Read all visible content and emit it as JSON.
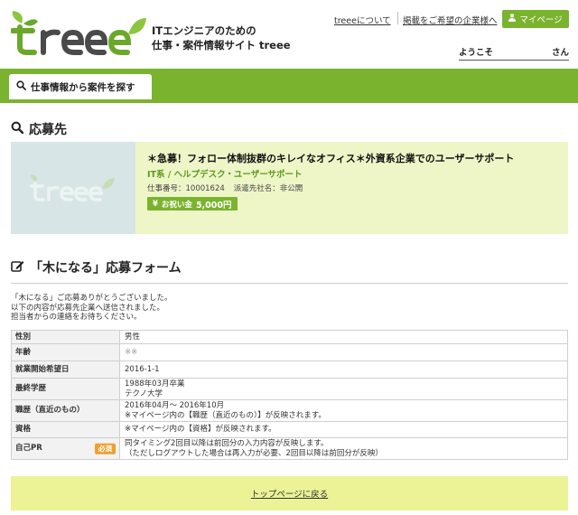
{
  "header": {
    "logo_text": "treee",
    "tagline_line1": "ITエンジニアのための",
    "tagline_line2": "仕事・案件情報サイト treee",
    "link_about": "treeeについて",
    "link_employers": "掲載をご希望の企業様へ",
    "mypage_label": "マイページ",
    "welcome_prefix": "ようこそ",
    "welcome_suffix": "さん"
  },
  "nav": {
    "search_tab": "仕事情報から案件を探す"
  },
  "apply_section": {
    "heading": "応募先"
  },
  "job": {
    "thumb_logo": "treee",
    "title": "＊急募！フォロー体制抜群のキレイなオフィス＊外資系企業でのユーザーサポート",
    "category": "IT系 / ヘルプデスク・ユーザーサポート",
    "job_number": "仕事番号：10001624",
    "company": "派遣先社名：非公開",
    "bonus_label": "お祝い金",
    "bonus_amount": "5,000円"
  },
  "form_section": {
    "heading": "「木になる」応募フォーム",
    "intro_line1": "「木になる」ご応募ありがとうございました。",
    "intro_line2": "以下の内容が応募先企業へ送信されました。",
    "intro_line3": "担当者からの連絡をお待ちください。",
    "required_label": "必須"
  },
  "rows": [
    {
      "label": "性別",
      "lines": [
        "男性"
      ]
    },
    {
      "label": "年齢",
      "lines": [
        "※※"
      ]
    },
    {
      "label": "就業開始希望日",
      "lines": [
        "2016-1-1"
      ]
    },
    {
      "label": "最終学歴",
      "lines": [
        "1988年03月卒業",
        "テクノ大学"
      ]
    },
    {
      "label": "職歴（直近のもの）",
      "lines": [
        "2016年04月～ 2016年10月",
        "※マイページ内の【職歴（直近のもの）】が反映されます。"
      ]
    },
    {
      "label": "資格",
      "lines": [
        "※マイページ内の【資格】が反映されます。"
      ]
    },
    {
      "label": "自己PR",
      "lines": [
        "同タイミング2回目以降は前回分の入力内容が反映します。",
        "（ただしログアウトした場合は再入力が必要、2回目以降は前回分が反映）"
      ]
    }
  ],
  "footer": {
    "top_link": "トップページに戻る"
  },
  "colors": {
    "brand_green": "#7ab32e",
    "card_bg": "#eef6c8",
    "footer_bg": "#ebf396",
    "required_badge": "#f0a030"
  }
}
